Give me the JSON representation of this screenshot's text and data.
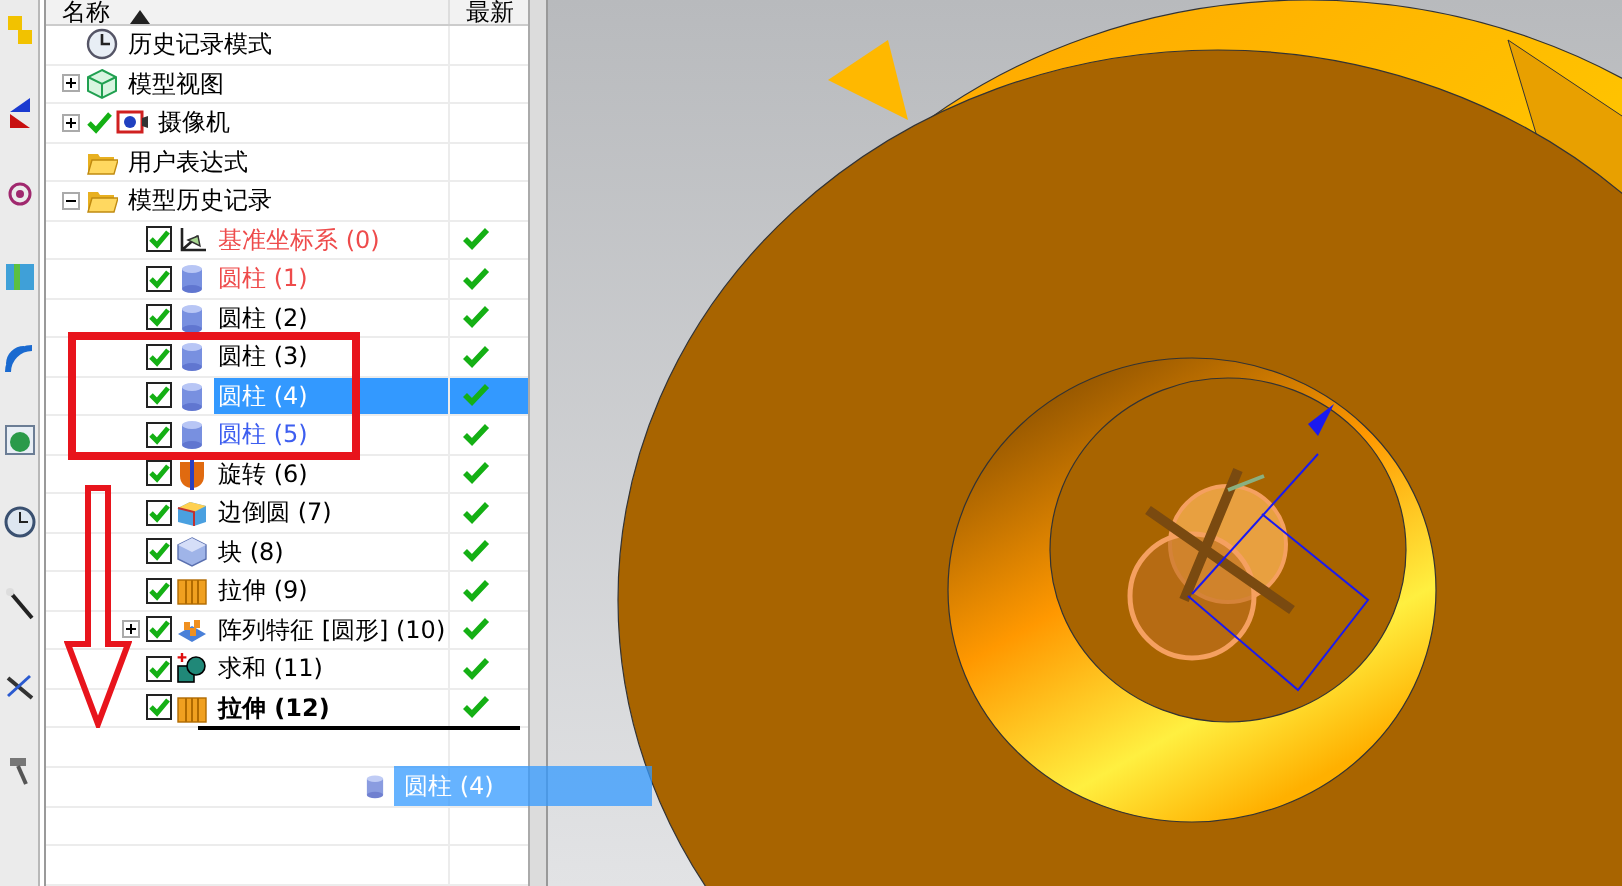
{
  "navigator": {
    "columns": [
      "名称",
      "最新"
    ]
  },
  "tree": [
    {
      "label": "历史记录模式",
      "kind": "clock"
    },
    {
      "label": "模型视图",
      "kind": "view",
      "expanded": false
    },
    {
      "label": "摄像机",
      "kind": "camera",
      "expanded": false,
      "checkmark": true
    },
    {
      "label": "用户表达式",
      "kind": "folder"
    },
    {
      "label": "模型历史记录",
      "kind": "folder",
      "expanded": true,
      "children": [
        {
          "label": "基准坐标系 (0)",
          "kind": "datum",
          "checked": true,
          "selected": false,
          "color": "#ee4b4b",
          "latest": true,
          "current": false
        },
        {
          "label": "圆柱 (1)",
          "kind": "cylinder",
          "checked": true,
          "selected": false,
          "color": "#ee4b4b",
          "latest": true,
          "current": false
        },
        {
          "label": "圆柱 (2)",
          "kind": "cylinder",
          "checked": true,
          "selected": false,
          "color": "#000000",
          "latest": true,
          "current": false
        },
        {
          "label": "圆柱 (3)",
          "kind": "cylinder",
          "checked": true,
          "selected": false,
          "color": "#000000",
          "latest": true,
          "current": false
        },
        {
          "label": "圆柱 (4)",
          "kind": "cylinder",
          "checked": true,
          "selected": true,
          "latest": true,
          "current": false
        },
        {
          "label": "圆柱 (5)",
          "kind": "cylinder",
          "checked": true,
          "selected": false,
          "color": "#3d5ef0",
          "latest": true,
          "current": false
        },
        {
          "label": "旋转 (6)",
          "kind": "revolve",
          "checked": true,
          "selected": false,
          "color": "#000000",
          "latest": true,
          "current": false
        },
        {
          "label": "边倒圆 (7)",
          "kind": "blend",
          "checked": true,
          "selected": false,
          "color": "#000000",
          "latest": true,
          "current": false
        },
        {
          "label": "块 (8)",
          "kind": "block",
          "checked": true,
          "selected": false,
          "color": "#000000",
          "latest": true,
          "current": false
        },
        {
          "label": "拉伸 (9)",
          "kind": "extrude",
          "checked": true,
          "selected": false,
          "color": "#000000",
          "latest": true,
          "current": false
        },
        {
          "label": "阵列特征 [圆形] (10)",
          "kind": "pattern",
          "expanded": false,
          "checked": true,
          "selected": false,
          "color": "#000000",
          "latest": true,
          "current": false
        },
        {
          "label": "求和 (11)",
          "kind": "unite",
          "checked": true,
          "selected": false,
          "color": "#000000",
          "latest": true,
          "current": false
        },
        {
          "label": "拉伸 (12)",
          "kind": "extrude",
          "checked": true,
          "selected": false,
          "color": "#000000",
          "latest": true,
          "current": true
        }
      ]
    }
  ],
  "drag_preview": {
    "label": "圆柱 (4)"
  }
}
